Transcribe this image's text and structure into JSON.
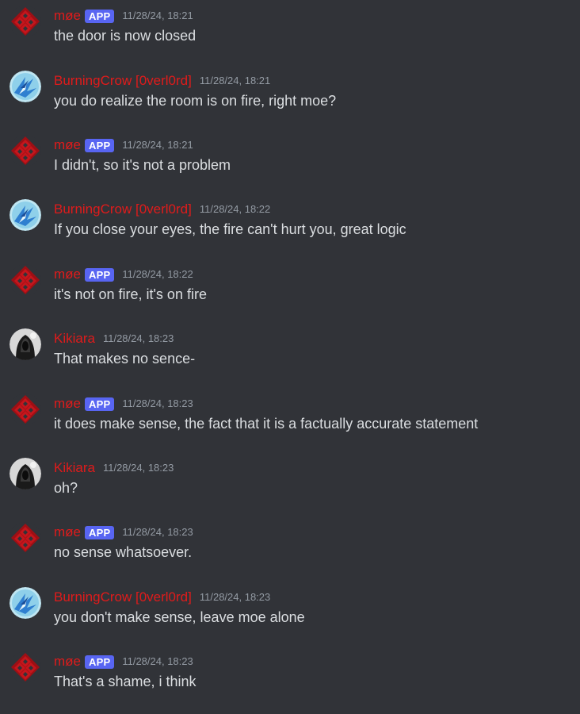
{
  "colors": {
    "background": "#313338",
    "username": "#e01b1b",
    "app_badge": "#5865f2",
    "timestamp": "#949ba4",
    "text": "#dbdee1"
  },
  "messages": [
    {
      "author": "møe",
      "badge": "APP",
      "avatar": "red-diamond-logo-icon",
      "time": "11/28/24, 18:21",
      "text": "the door is now closed"
    },
    {
      "author": "BurningCrow [0verl0rd]",
      "badge": null,
      "avatar": "blue-crow-avatar-icon",
      "time": "11/28/24, 18:21",
      "text": "you do realize the room is on fire, right moe?"
    },
    {
      "author": "møe",
      "badge": "APP",
      "avatar": "red-diamond-logo-icon",
      "time": "11/28/24, 18:21",
      "text": "I didn't, so it's not a problem"
    },
    {
      "author": "BurningCrow [0verl0rd]",
      "badge": null,
      "avatar": "blue-crow-avatar-icon",
      "time": "11/28/24, 18:22",
      "text": "If you close your eyes, the fire can't hurt you, great logic"
    },
    {
      "author": "møe",
      "badge": "APP",
      "avatar": "red-diamond-logo-icon",
      "time": "11/28/24, 18:22",
      "text": "it's not on fire, it's on fire"
    },
    {
      "author": "Kikiara",
      "badge": null,
      "avatar": "dark-hooded-avatar-icon",
      "time": "11/28/24, 18:23",
      "text": "That makes no sence-"
    },
    {
      "author": "møe",
      "badge": "APP",
      "avatar": "red-diamond-logo-icon",
      "time": "11/28/24, 18:23",
      "text": "it does make sense, the fact that it is a factually accurate statement"
    },
    {
      "author": "Kikiara",
      "badge": null,
      "avatar": "dark-hooded-avatar-icon",
      "time": "11/28/24, 18:23",
      "text": "oh?"
    },
    {
      "author": "møe",
      "badge": "APP",
      "avatar": "red-diamond-logo-icon",
      "time": "11/28/24, 18:23",
      "text": "no sense whatsoever."
    },
    {
      "author": "BurningCrow [0verl0rd]",
      "badge": null,
      "avatar": "blue-crow-avatar-icon",
      "time": "11/28/24, 18:23",
      "text": "you don't make sense, leave moe alone"
    },
    {
      "author": "møe",
      "badge": "APP",
      "avatar": "red-diamond-logo-icon",
      "time": "11/28/24, 18:23",
      "text": "That's a shame, i think"
    }
  ]
}
